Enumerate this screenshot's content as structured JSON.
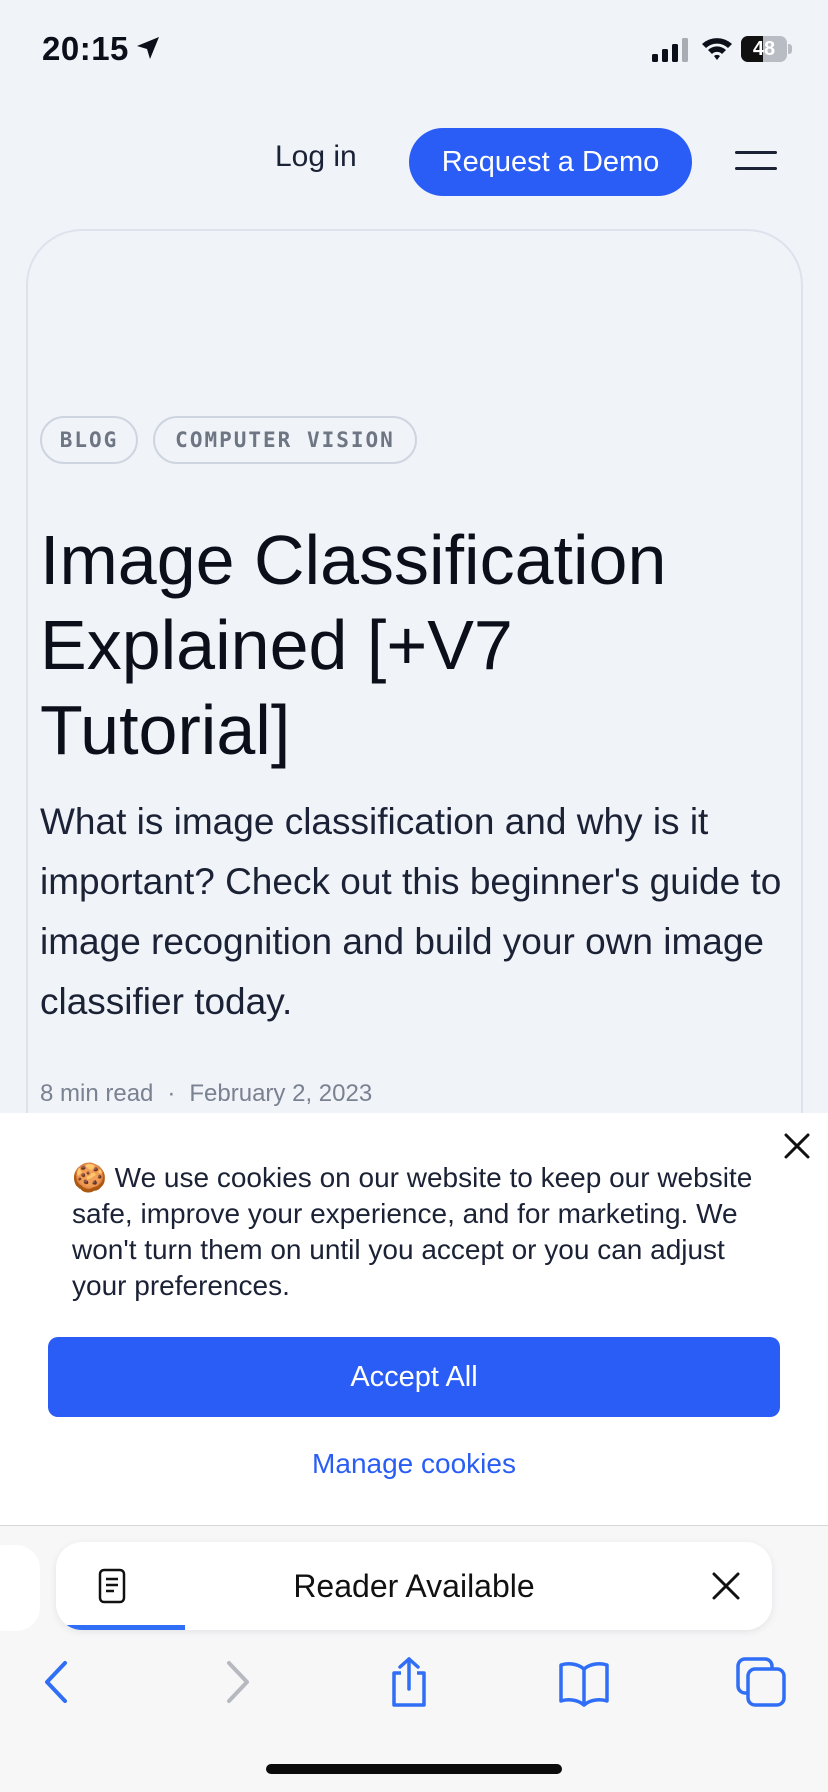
{
  "status_bar": {
    "time": "20:15",
    "battery_level": "48",
    "battery_fraction": 0.48
  },
  "nav": {
    "login_label": "Log in",
    "demo_label": "Request a Demo",
    "menu_icon": "hamburger-icon"
  },
  "article": {
    "tags": [
      "BLOG",
      "COMPUTER VISION"
    ],
    "title": "Image Classification Explained [+V7 Tutorial]",
    "subtitle": "What is image classification and why is it important? Check out this beginner's guide to image recognition and build your own image classifier today.",
    "read_time": "8 min read",
    "separator": "·",
    "date": "February 2, 2023"
  },
  "cookie_banner": {
    "icon": "🍪",
    "text": "We use cookies on our website to keep our website safe, improve your experience, and for marketing. We won't turn them on until you accept or you can adjust your preferences.",
    "accept_label": "Accept All",
    "manage_label": "Manage cookies"
  },
  "safari": {
    "reader_label": "Reader Available",
    "page_load_progress": 0.18,
    "toolbar_icons": [
      "back-icon",
      "forward-icon",
      "share-icon",
      "bookmarks-icon",
      "tabs-icon"
    ]
  },
  "colors": {
    "accent": "#2a5df5",
    "background": "#f0f3f8",
    "text": "#0b0f1a",
    "muted": "#7a8190"
  }
}
